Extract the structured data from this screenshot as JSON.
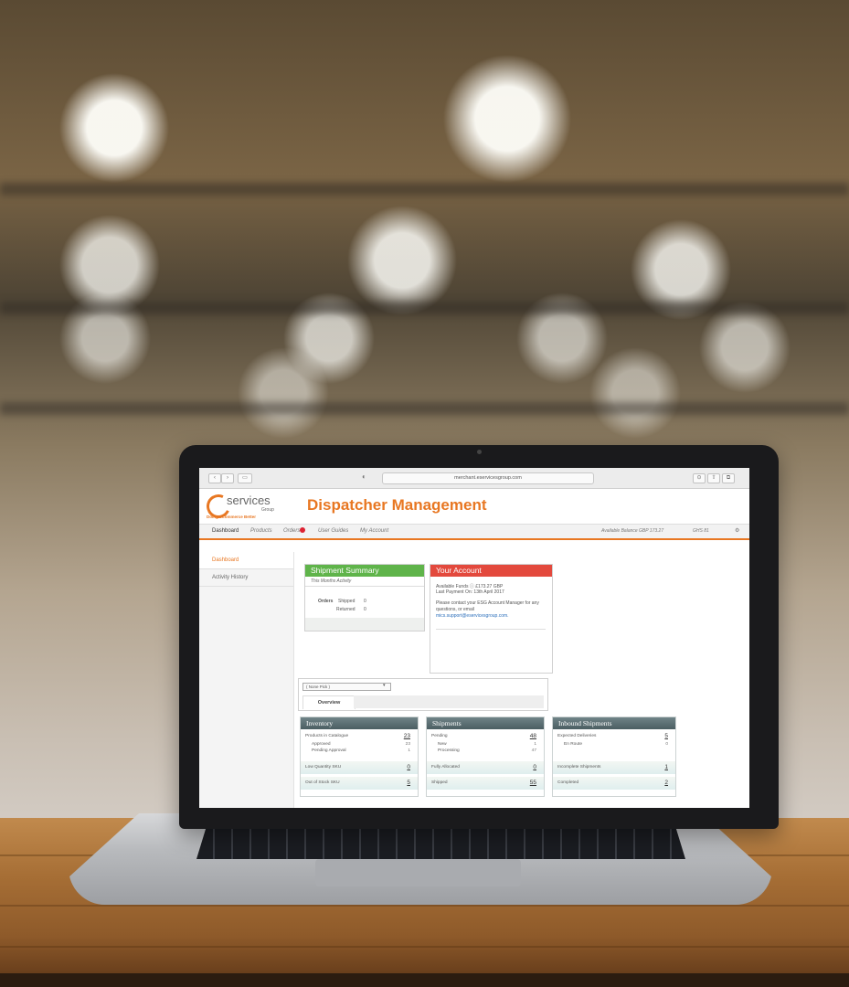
{
  "browser": {
    "url": "merchant.eservicesgroup.com"
  },
  "app": {
    "logo_text": "services",
    "logo_group": "Group",
    "logo_tagline": "Doing eCommerce Better",
    "title": "Dispatcher Management"
  },
  "nav": {
    "items": [
      "Dashboard",
      "Products",
      "Orders",
      "User Guides",
      "My Account"
    ],
    "balance": "Available Balance GBP 173.27",
    "currency": "GHS 81"
  },
  "sidebar": {
    "items": [
      "Dashboard",
      "Activity History"
    ]
  },
  "shipment_summary": {
    "title": "Shipment Summary",
    "subtitle": "This Months Activity",
    "orders_label": "Orders",
    "shipped_label": "Shipped",
    "shipped_value": "0",
    "returned_label": "Returned",
    "returned_value": "0",
    "header_color": "#5fb44a"
  },
  "your_account": {
    "title": "Your Account",
    "available_funds": "Available Funds ⓘ  £173.27 GBP",
    "last_payment": "Last Payment On:  13th April 2017",
    "contact_text": "Please contact your ESG Account Manager for any questions, or email",
    "email": "mics.support@eservicesgroup.com.",
    "header_color": "#e3493d"
  },
  "filter": {
    "select_value": "( None Pick )",
    "tab_overview": "Overview"
  },
  "inventory": {
    "title": "Inventory",
    "rows": [
      {
        "label": "Products in Catalogue",
        "value": "23"
      },
      {
        "label": "Approved",
        "value": "23"
      },
      {
        "label": "Pending Approval",
        "value": "1"
      },
      {
        "label": "Low Quantity SKU",
        "value": "0"
      },
      {
        "label": "Out of Stock SKU",
        "value": "5"
      }
    ]
  },
  "shipments": {
    "title": "Shipments",
    "rows": [
      {
        "label": "Pending",
        "value": "48"
      },
      {
        "label": "New",
        "value": "1"
      },
      {
        "label": "Processing",
        "value": "47"
      },
      {
        "label": "Fully Allocated",
        "value": "0"
      },
      {
        "label": "Shipped",
        "value": "55"
      }
    ]
  },
  "inbound": {
    "title": "Inbound Shipments",
    "rows": [
      {
        "label": "Expected Deliveries",
        "value": "5"
      },
      {
        "label": "En Route",
        "value": "0"
      },
      {
        "label": "Incomplete Shipments",
        "value": "1"
      },
      {
        "label": "Completed",
        "value": "2"
      }
    ]
  },
  "colors": {
    "accent": "#e87722"
  }
}
